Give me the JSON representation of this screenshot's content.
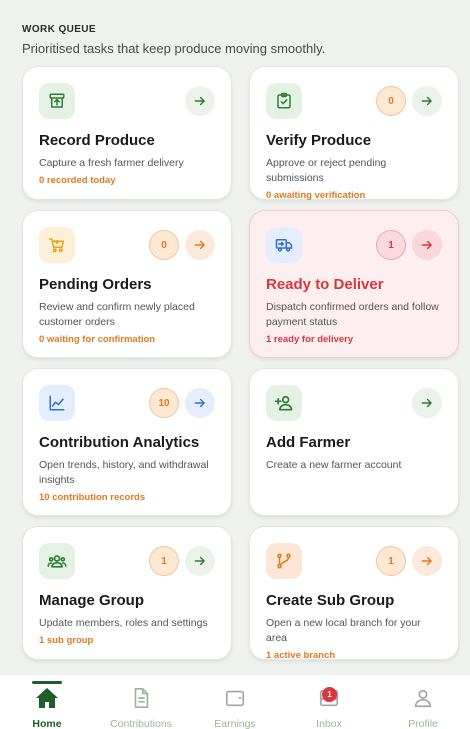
{
  "header": {
    "eyebrow": "WORK QUEUE",
    "subtitle": "Prioritised tasks that keep produce moving smoothly."
  },
  "cards": [
    {
      "title": "Record Produce",
      "desc": "Capture a fresh farmer delivery",
      "meta": "0 recorded today",
      "icon": "archive-upload-icon"
    },
    {
      "title": "Verify Produce",
      "badge": "0",
      "desc": "Approve or reject pending submissions",
      "meta": "0 awaiting verification",
      "icon": "clipboard-check-icon"
    },
    {
      "title": "Pending Orders",
      "badge": "0",
      "desc": "Review and confirm newly placed customer orders",
      "meta": "0 waiting for confirmation",
      "icon": "cart-icon"
    },
    {
      "title": "Ready to Deliver",
      "badge": "1",
      "desc": "Dispatch confirmed orders and follow payment status",
      "meta": "1 ready for delivery",
      "icon": "delivery-truck-icon"
    },
    {
      "title": "Contribution Analytics",
      "badge": "10",
      "desc": "Open trends, history, and withdrawal insights",
      "meta": "10 contribution records",
      "icon": "line-chart-icon"
    },
    {
      "title": "Add Farmer",
      "desc": "Create a new farmer account",
      "icon": "add-person-icon"
    },
    {
      "title": "Manage Group",
      "badge": "1",
      "desc": "Update members, roles and settings",
      "meta": "1 sub group",
      "icon": "group-icon"
    },
    {
      "title": "Create Sub Group",
      "badge": "1",
      "desc": "Open a new local branch for your area",
      "meta": "1 active branch",
      "icon": "branch-icon"
    }
  ],
  "nav": {
    "home": "Home",
    "contributions": "Contributions",
    "earnings": "Earnings",
    "inbox": "Inbox",
    "inbox_badge": "1",
    "profile": "Profile"
  },
  "colors": {
    "brand_green": "#1f5e2a",
    "accent_orange": "#e07a1f",
    "alert_red": "#d9363e"
  }
}
